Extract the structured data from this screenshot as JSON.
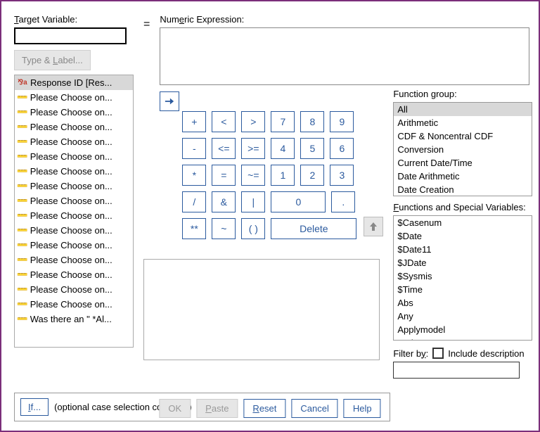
{
  "target": {
    "label": "Target Variable:",
    "value": ""
  },
  "type_label_btn": "Type & Label...",
  "equals": "=",
  "numexpr": {
    "label": "Numeric Expression:",
    "value": ""
  },
  "variables": [
    {
      "name": "Response ID [Res...",
      "icon": "string",
      "sel": true
    },
    {
      "name": "Please Choose on...",
      "icon": "ruler"
    },
    {
      "name": "Please Choose on...",
      "icon": "ruler"
    },
    {
      "name": "Please Choose on...",
      "icon": "ruler"
    },
    {
      "name": "Please Choose on...",
      "icon": "ruler"
    },
    {
      "name": "Please Choose on...",
      "icon": "ruler"
    },
    {
      "name": "Please Choose on...",
      "icon": "ruler"
    },
    {
      "name": "Please Choose on...",
      "icon": "ruler"
    },
    {
      "name": "Please Choose on...",
      "icon": "ruler"
    },
    {
      "name": "Please Choose on...",
      "icon": "ruler"
    },
    {
      "name": "Please Choose on...",
      "icon": "ruler"
    },
    {
      "name": "Please Choose on...",
      "icon": "ruler"
    },
    {
      "name": "Please Choose on...",
      "icon": "ruler"
    },
    {
      "name": "Please Choose on...",
      "icon": "ruler"
    },
    {
      "name": "Please Choose on...",
      "icon": "ruler"
    },
    {
      "name": "Please Choose on...",
      "icon": "ruler"
    },
    {
      "name": "Was there an \" *Al...",
      "icon": "ruler"
    }
  ],
  "keypad": [
    [
      "+",
      "<",
      ">",
      "7",
      "8",
      "9"
    ],
    [
      "-",
      "<=",
      ">=",
      "4",
      "5",
      "6"
    ],
    [
      "*",
      "=",
      "~=",
      "1",
      "2",
      "3"
    ],
    [
      "/",
      "&",
      "|",
      "0",
      "."
    ],
    [
      "**",
      "~",
      "( )",
      "Delete"
    ]
  ],
  "function_group": {
    "label": "Function group:",
    "items": [
      "All",
      "Arithmetic",
      "CDF & Noncentral CDF",
      "Conversion",
      "Current Date/Time",
      "Date Arithmetic",
      "Date Creation"
    ],
    "selected": "All"
  },
  "functions": {
    "label": "Functions and Special Variables:",
    "items": [
      "$Casenum",
      "$Date",
      "$Date11",
      "$JDate",
      "$Sysmis",
      "$Time",
      "Abs",
      "Any",
      "Applymodel",
      "Arsin"
    ]
  },
  "filter": {
    "label": "Filter by:",
    "include_desc": "Include description",
    "value": ""
  },
  "if": {
    "btn": "If...",
    "text": "(optional case selection condition)"
  },
  "buttons": {
    "ok": "OK",
    "paste": "Paste",
    "reset": "Reset",
    "cancel": "Cancel",
    "help": "Help"
  }
}
